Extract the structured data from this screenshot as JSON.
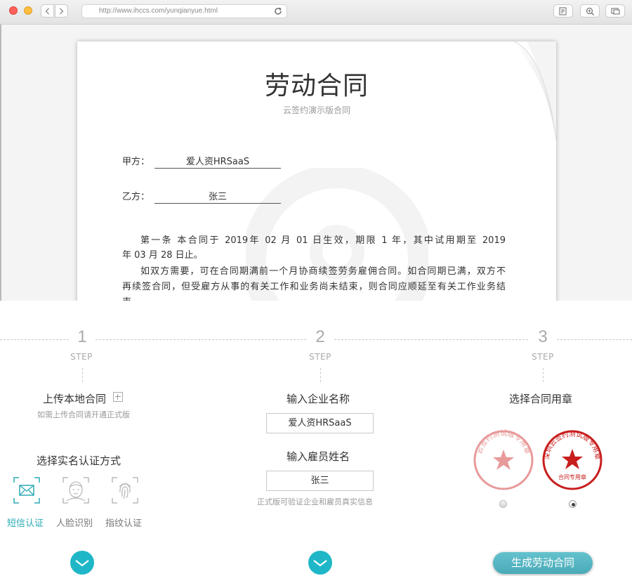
{
  "browser": {
    "url": "http://www.ihccs.com/yunqianyue.html"
  },
  "document": {
    "title": "劳动合同",
    "subtitle": "云签约演示版合同",
    "party_a_label": "甲方：",
    "party_a_value": "爱人资HRSaaS",
    "party_b_label": "乙方：",
    "party_b_value": "张三",
    "clause_lines": [
      "第一条 本合同于 2019年 02 月 01 日生效，期限 1 年，其中试用期至 2019",
      "年 03 月 28 日止。",
      "如双方需要，可在合同期满前一个月协商续签劳务雇佣合同。如合同期已满，双方不",
      "再续签合同，但受雇方从事的有关工作和业务尚未结束，则合同应顺延至有关工作业务结",
      "束。"
    ]
  },
  "steps": [
    {
      "number": "1",
      "label": "STEP"
    },
    {
      "number": "2",
      "label": "STEP"
    },
    {
      "number": "3",
      "label": "STEP"
    }
  ],
  "step1": {
    "upload_title": "上传本地合同",
    "upload_note": "如需上传合同请开通正式版",
    "auth_title": "选择实名认证方式",
    "auth_options": [
      "短信认证",
      "人脸识别",
      "指纹认证"
    ],
    "selected_auth": "短信认证"
  },
  "step2": {
    "company_label": "输入企业名称",
    "company_value": "爱人资HRSaaS",
    "employee_label": "输入雇员姓名",
    "employee_value": "张三",
    "note": "正式版可验证企业和雇员真实信息"
  },
  "step3": {
    "seal_title": "选择合同用章",
    "seals": [
      {
        "text": "云签约测试版专用章",
        "sub": "",
        "color": "#e89a9a",
        "selected": false
      },
      {
        "text": "深圳云签约测试版专用章",
        "sub": "合同专用章",
        "color": "#c81e1e",
        "selected": true
      }
    ],
    "generate_button": "生成劳动合同"
  },
  "colors": {
    "accent": "#2aaab5",
    "button": "#4fb0bc",
    "check": "#1fb7c7"
  }
}
